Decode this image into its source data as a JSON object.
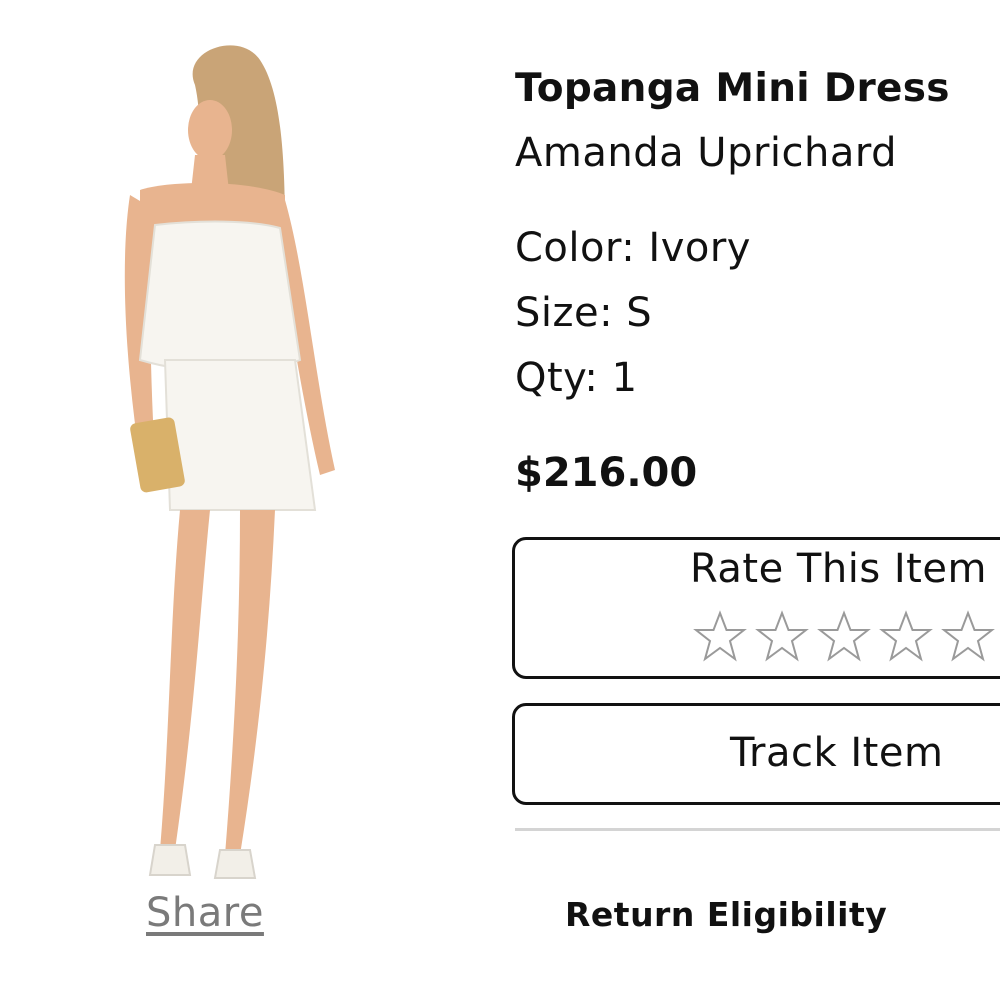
{
  "product": {
    "name": "Topanga Mini Dress",
    "brand": "Amanda Uprichard",
    "color_line": "Color: Ivory",
    "size_line": "Size: S",
    "qty_line": "Qty: 1",
    "price": "$216.00"
  },
  "image": {
    "icon": "product-photo",
    "dress_color": "#f7f5f0",
    "skin_color": "#e8b48f",
    "hair_color": "#c9a477",
    "bag_color": "#d9b16a"
  },
  "actions": {
    "share_label": "Share",
    "rate_title": "Rate This Item",
    "rating": {
      "value": 0,
      "max": 5
    },
    "track_label": "Track Item",
    "return_label": "Return Eligibility"
  },
  "colors": {
    "text": "#111111",
    "muted_link": "#7a7a7a",
    "divider": "#d4d4d4",
    "star_outline": "#9a9a9a"
  }
}
